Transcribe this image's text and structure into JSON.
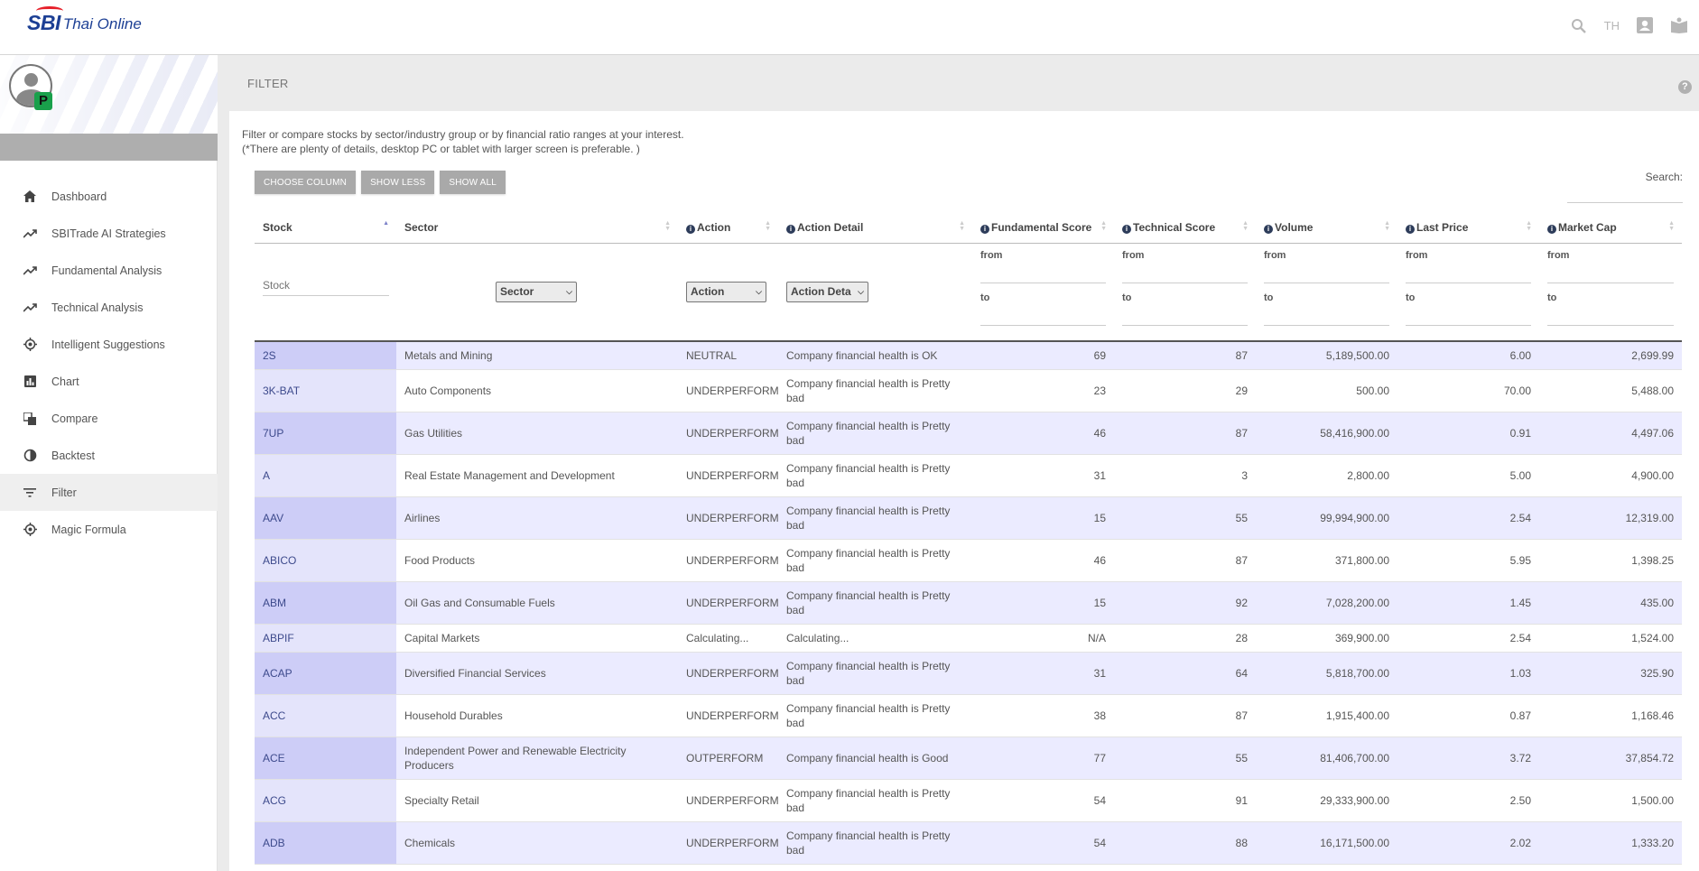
{
  "app": {
    "logo_brand": "SBI",
    "logo_sub": "Thai Online",
    "lang": "TH"
  },
  "sidebar": {
    "avatar_badge": "P",
    "items": [
      {
        "label": "Dashboard",
        "icon": "home-icon"
      },
      {
        "label": "SBITrade AI Strategies",
        "icon": "trend-icon"
      },
      {
        "label": "Fundamental Analysis",
        "icon": "trend-icon"
      },
      {
        "label": "Technical Analysis",
        "icon": "trend-icon"
      },
      {
        "label": "Intelligent Suggestions",
        "icon": "target-icon"
      },
      {
        "label": "Chart",
        "icon": "bar-chart-icon"
      },
      {
        "label": "Compare",
        "icon": "compare-icon"
      },
      {
        "label": "Backtest",
        "icon": "backtest-icon"
      },
      {
        "label": "Filter",
        "icon": "filter-icon",
        "active": true
      },
      {
        "label": "Magic Formula",
        "icon": "target-icon"
      }
    ]
  },
  "page": {
    "title": "FILTER",
    "desc_line1": "Filter or compare stocks by sector/industry group or by financial ratio ranges at your interest.",
    "desc_line2": "(*There are plenty of details, desktop PC or tablet with larger screen is preferable. )",
    "btn_choose": "CHOOSE COLUMN",
    "btn_less": "SHOW LESS",
    "btn_all": "SHOW ALL",
    "search_label": "Search:"
  },
  "table": {
    "headers": {
      "stock": "Stock",
      "sector": "Sector",
      "action": "Action",
      "action_detail": "Action Detail",
      "fundamental": "Fundamental Score",
      "technical": "Technical Score",
      "volume": "Volume",
      "last_price": "Last Price",
      "market_cap": "Market Cap"
    },
    "filters": {
      "stock_placeholder": "Stock",
      "sector_select": "Sector",
      "action_select": "Action",
      "action_detail_select": "Action Deta",
      "from": "from",
      "to": "to"
    },
    "rows": [
      [
        "2S",
        "Metals and Mining",
        "NEUTRAL",
        "Company financial health is OK",
        "69",
        "87",
        "5,189,500.00",
        "6.00",
        "2,699.99"
      ],
      [
        "3K-BAT",
        "Auto Components",
        "UNDERPERFORM",
        "Company financial health is Pretty bad",
        "23",
        "29",
        "500.00",
        "70.00",
        "5,488.00"
      ],
      [
        "7UP",
        "Gas Utilities",
        "UNDERPERFORM",
        "Company financial health is Pretty bad",
        "46",
        "87",
        "58,416,900.00",
        "0.91",
        "4,497.06"
      ],
      [
        "A",
        "Real Estate Management and Development",
        "UNDERPERFORM",
        "Company financial health is Pretty bad",
        "31",
        "3",
        "2,800.00",
        "5.00",
        "4,900.00"
      ],
      [
        "AAV",
        "Airlines",
        "UNDERPERFORM",
        "Company financial health is Pretty bad",
        "15",
        "55",
        "99,994,900.00",
        "2.54",
        "12,319.00"
      ],
      [
        "ABICO",
        "Food Products",
        "UNDERPERFORM",
        "Company financial health is Pretty bad",
        "46",
        "87",
        "371,800.00",
        "5.95",
        "1,398.25"
      ],
      [
        "ABM",
        "Oil Gas and Consumable Fuels",
        "UNDERPERFORM",
        "Company financial health is Pretty bad",
        "15",
        "92",
        "7,028,200.00",
        "1.45",
        "435.00"
      ],
      [
        "ABPIF",
        "Capital Markets",
        "Calculating...",
        "Calculating...",
        "N/A",
        "28",
        "369,900.00",
        "2.54",
        "1,524.00"
      ],
      [
        "ACAP",
        "Diversified Financial Services",
        "UNDERPERFORM",
        "Company financial health is Pretty bad",
        "31",
        "64",
        "5,818,700.00",
        "1.03",
        "325.90"
      ],
      [
        "ACC",
        "Household Durables",
        "UNDERPERFORM",
        "Company financial health is Pretty bad",
        "38",
        "87",
        "1,915,400.00",
        "0.87",
        "1,168.46"
      ],
      [
        "ACE",
        "Independent Power and Renewable Electricity Producers",
        "OUTPERFORM",
        "Company financial health is Good",
        "77",
        "55",
        "81,406,700.00",
        "3.72",
        "37,854.72"
      ],
      [
        "ACG",
        "Specialty Retail",
        "UNDERPERFORM",
        "Company financial health is Pretty bad",
        "54",
        "91",
        "29,333,900.00",
        "2.50",
        "1,500.00"
      ],
      [
        "ADB",
        "Chemicals",
        "UNDERPERFORM",
        "Company financial health is Pretty bad",
        "54",
        "88",
        "16,171,500.00",
        "2.02",
        "1,333.20"
      ]
    ]
  },
  "colors": {
    "brand_blue": "#1c3f94",
    "brand_red": "#e6202a",
    "row_alt": "#ebebff",
    "stock_cell": "#cdcdf7",
    "button_gray": "#a9a9a9"
  }
}
